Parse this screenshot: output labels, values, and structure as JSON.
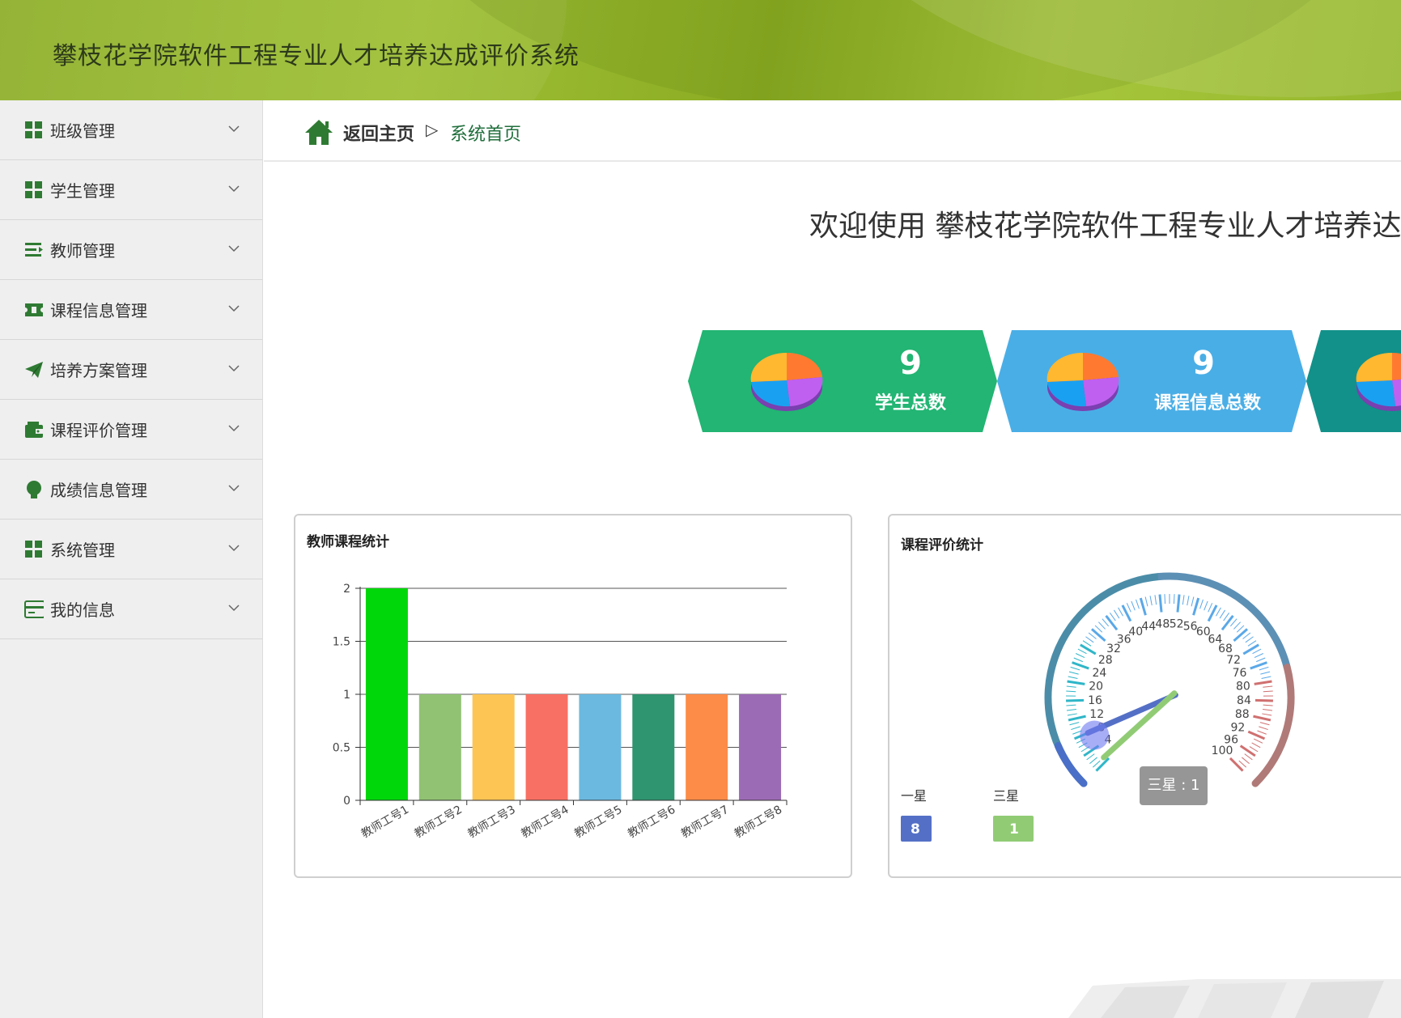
{
  "header": {
    "title": "攀枝花学院软件工程专业人才培养达成评价系统"
  },
  "sidebar": {
    "items": [
      {
        "label": "班级管理",
        "icon": "grid-icon"
      },
      {
        "label": "学生管理",
        "icon": "grid-icon"
      },
      {
        "label": "教师管理",
        "icon": "list-icon"
      },
      {
        "label": "课程信息管理",
        "icon": "ticket-icon"
      },
      {
        "label": "培养方案管理",
        "icon": "paper-plane-icon"
      },
      {
        "label": "课程评价管理",
        "icon": "wallet-icon"
      },
      {
        "label": "成绩信息管理",
        "icon": "bulb-icon"
      },
      {
        "label": "系统管理",
        "icon": "grid-icon"
      },
      {
        "label": "我的信息",
        "icon": "card-icon"
      }
    ]
  },
  "breadcrumb": {
    "home": "返回主页",
    "separator": "▷",
    "current": "系统首页"
  },
  "welcome": "欢迎使用 攀枝花学院软件工程专业人才培养达成",
  "stats": [
    {
      "value": "9",
      "label": "学生总数",
      "color": "#22b573"
    },
    {
      "value": "9",
      "label": "课程信息总数",
      "color": "#4aaee6"
    },
    {
      "value": "",
      "label": "",
      "color": "#12918a"
    }
  ],
  "bar_panel": {
    "title": "教师课程统计"
  },
  "gauge_panel": {
    "title": "课程评价统计",
    "legend": [
      {
        "name": "一星",
        "value": "8",
        "color": "#5470c6"
      },
      {
        "name": "三星",
        "value": "1",
        "color": "#91cc75"
      }
    ],
    "tooltip": "三星 : 1"
  },
  "chart_data": [
    {
      "type": "bar",
      "categories": [
        "教师工号1",
        "教师工号2",
        "教师工号3",
        "教师工号4",
        "教师工号5",
        "教师工号6",
        "教师工号7",
        "教师工号8"
      ],
      "values": [
        2,
        1,
        1,
        1,
        1,
        1,
        1,
        1
      ],
      "colors": [
        "#00d70a",
        "#91c274",
        "#fcc554",
        "#f87064",
        "#6bb9e0",
        "#2f9470",
        "#fd8c48",
        "#9c6bb5"
      ],
      "yticks": [
        "0",
        "0.5",
        "1",
        "1.5",
        "2"
      ],
      "ylim": [
        0,
        2
      ],
      "grid": true
    },
    {
      "type": "gauge",
      "min": 0,
      "max": 100,
      "ticks": [
        "4",
        "8",
        "12",
        "16",
        "20",
        "24",
        "28",
        "32",
        "36",
        "40",
        "44",
        "48",
        "52",
        "56",
        "60",
        "64",
        "68",
        "72",
        "76",
        "80",
        "84",
        "88",
        "92",
        "96",
        "100"
      ],
      "series": [
        {
          "name": "一星",
          "value": 8,
          "color": "#5470c6"
        },
        {
          "name": "三星",
          "value": 1,
          "color": "#91cc75"
        }
      ]
    }
  ]
}
